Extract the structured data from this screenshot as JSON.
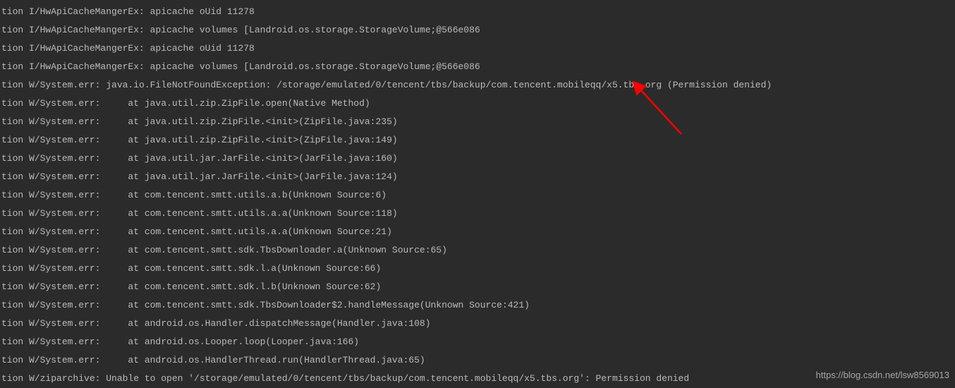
{
  "log": {
    "lines": [
      "tion I/HwApiCacheMangerEx: apicache oUid 11278",
      "tion I/HwApiCacheMangerEx: apicache volumes [Landroid.os.storage.StorageVolume;@566e086",
      "tion I/HwApiCacheMangerEx: apicache oUid 11278",
      "tion I/HwApiCacheMangerEx: apicache volumes [Landroid.os.storage.StorageVolume;@566e086",
      "tion W/System.err: java.io.FileNotFoundException: /storage/emulated/0/tencent/tbs/backup/com.tencent.mobileqq/x5.tbs.org (Permission denied)",
      "tion W/System.err:     at java.util.zip.ZipFile.open(Native Method)",
      "tion W/System.err:     at java.util.zip.ZipFile.<init>(ZipFile.java:235)",
      "tion W/System.err:     at java.util.zip.ZipFile.<init>(ZipFile.java:149)",
      "tion W/System.err:     at java.util.jar.JarFile.<init>(JarFile.java:160)",
      "tion W/System.err:     at java.util.jar.JarFile.<init>(JarFile.java:124)",
      "tion W/System.err:     at com.tencent.smtt.utils.a.b(Unknown Source:6)",
      "tion W/System.err:     at com.tencent.smtt.utils.a.a(Unknown Source:118)",
      "tion W/System.err:     at com.tencent.smtt.utils.a.a(Unknown Source:21)",
      "tion W/System.err:     at com.tencent.smtt.sdk.TbsDownloader.a(Unknown Source:65)",
      "tion W/System.err:     at com.tencent.smtt.sdk.l.a(Unknown Source:66)",
      "tion W/System.err:     at com.tencent.smtt.sdk.l.b(Unknown Source:62)",
      "tion W/System.err:     at com.tencent.smtt.sdk.TbsDownloader$2.handleMessage(Unknown Source:421)",
      "tion W/System.err:     at android.os.Handler.dispatchMessage(Handler.java:108)",
      "tion W/System.err:     at android.os.Looper.loop(Looper.java:166)",
      "tion W/System.err:     at android.os.HandlerThread.run(HandlerThread.java:65)",
      "tion W/ziparchive: Unable to open '/storage/emulated/0/tencent/tbs/backup/com.tencent.mobileqq/x5.tbs.org': Permission denied"
    ]
  },
  "watermark": "https://blog.csdn.net/lsw8569013",
  "annotation": {
    "arrow_color": "#ff0000"
  }
}
